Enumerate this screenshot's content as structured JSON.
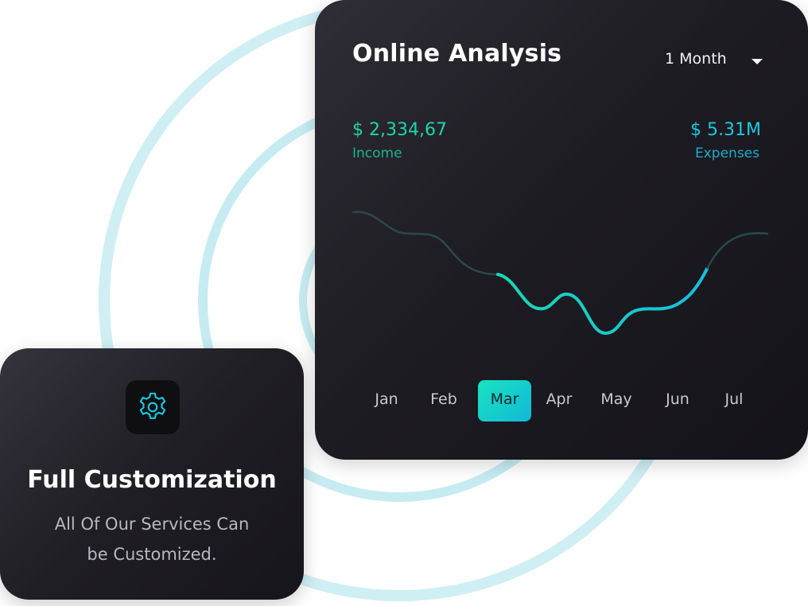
{
  "analysis_card": {
    "title": "Online Analysis",
    "period": "1 Month",
    "income": {
      "value": "$ 2,334,67",
      "label": "Income"
    },
    "expenses": {
      "value": "$ 5.31M",
      "label": "Expenses"
    },
    "months": [
      "Jan",
      "Feb",
      "Mar",
      "Apr",
      "May",
      "Jun",
      "Jul"
    ],
    "active_month": "Mar"
  },
  "customization_card": {
    "icon": "gear-icon",
    "title": "Full Customization",
    "line1": "All Of Our Services Can",
    "line2": "be Customized."
  },
  "colors": {
    "accent_green": "#1ed3b0",
    "accent_cyan": "#1cc9df",
    "ring": "#c9eef3",
    "card_dark": "#1d1c22"
  }
}
